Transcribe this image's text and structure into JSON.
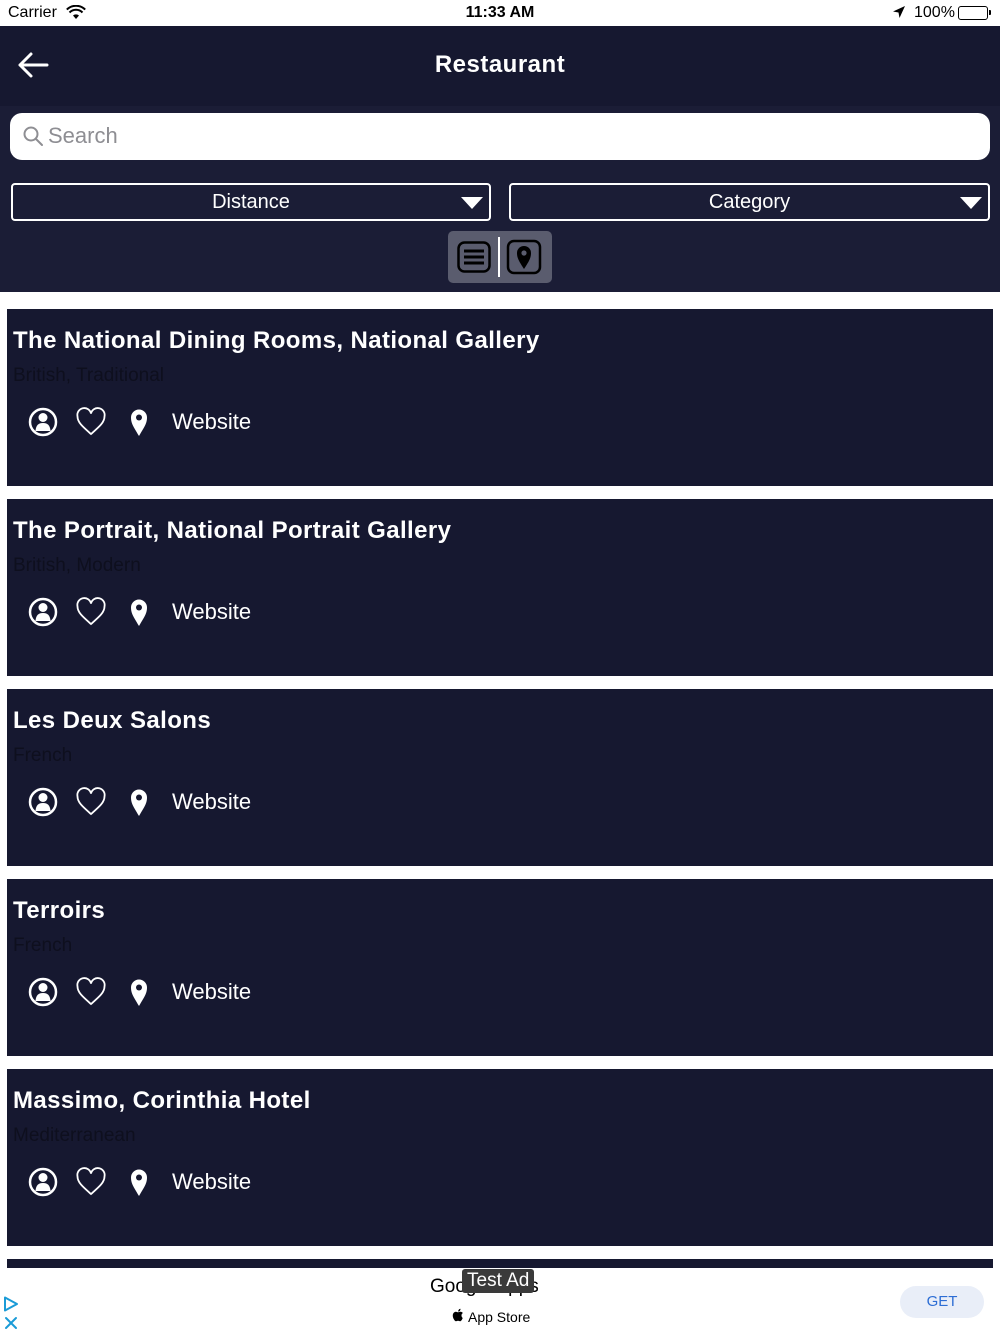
{
  "status_bar": {
    "carrier": "Carrier",
    "time": "11:33 AM",
    "battery": "100%"
  },
  "header": {
    "title": "Restaurant",
    "back_icon": "arrow-left-icon"
  },
  "search": {
    "placeholder": "Search",
    "value": ""
  },
  "filters": {
    "distance_label": "Distance",
    "category_label": "Category"
  },
  "view_toggle": {
    "list_icon": "list-icon",
    "map_icon": "map-pin-icon"
  },
  "restaurants": [
    {
      "name": "The National Dining Rooms, National Gallery",
      "cuisine": "British, Traditional",
      "website_label": "Website"
    },
    {
      "name": "The Portrait, National Portrait Gallery",
      "cuisine": "British, Modern",
      "website_label": "Website"
    },
    {
      "name": "Les Deux Salons",
      "cuisine": "French",
      "website_label": "Website"
    },
    {
      "name": "Terroirs",
      "cuisine": "French",
      "website_label": "Website"
    },
    {
      "name": "Massimo, Corinthia Hotel",
      "cuisine": "Mediterranean",
      "website_label": "Website"
    }
  ],
  "ad": {
    "title": "Google Apps",
    "test_label": "Test Ad",
    "store": "App Store",
    "cta": "GET"
  },
  "colors": {
    "header_bg": "#161830",
    "toolbar_bg": "#1b1d36",
    "card_bg": "#161830",
    "cta_blue": "#2c6dd4"
  }
}
